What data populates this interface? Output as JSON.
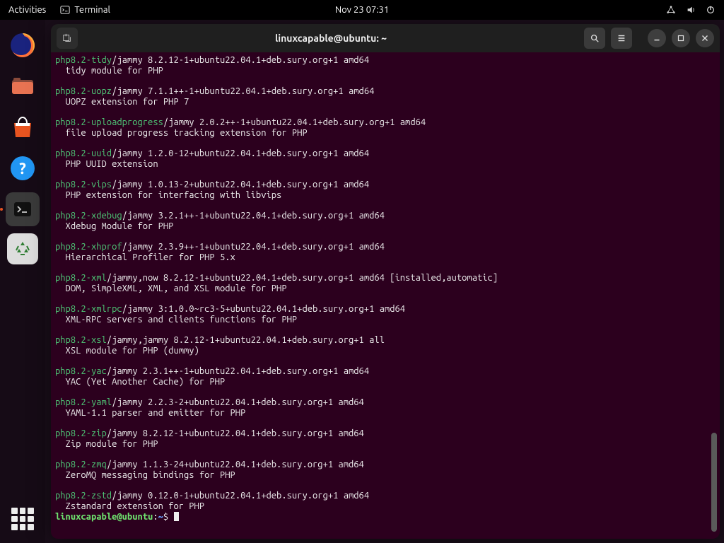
{
  "topbar": {
    "activities": "Activities",
    "terminal": "Terminal",
    "datetime": "Nov 23  07:31"
  },
  "window": {
    "title": "linuxcapable@ubuntu: ~"
  },
  "prompt": {
    "user_host": "linuxcapable@ubuntu",
    "sep": ":",
    "path": "~",
    "dollar": "$ "
  },
  "packages": [
    {
      "name": "php8.2-tidy",
      "version": "/jammy 8.2.12-1+ubuntu22.04.1+deb.sury.org+1 amd64",
      "desc": "  tidy module for PHP"
    },
    {
      "name": "php8.2-uopz",
      "version": "/jammy 7.1.1++-1+ubuntu22.04.1+deb.sury.org+1 amd64",
      "desc": "  UOPZ extension for PHP 7"
    },
    {
      "name": "php8.2-uploadprogress",
      "version": "/jammy 2.0.2++-1+ubuntu22.04.1+deb.sury.org+1 amd64",
      "desc": "  file upload progress tracking extension for PHP"
    },
    {
      "name": "php8.2-uuid",
      "version": "/jammy 1.2.0-12+ubuntu22.04.1+deb.sury.org+1 amd64",
      "desc": "  PHP UUID extension"
    },
    {
      "name": "php8.2-vips",
      "version": "/jammy 1.0.13-2+ubuntu22.04.1+deb.sury.org+1 amd64",
      "desc": "  PHP extension for interfacing with libvips"
    },
    {
      "name": "php8.2-xdebug",
      "version": "/jammy 3.2.1++-1+ubuntu22.04.1+deb.sury.org+1 amd64",
      "desc": "  Xdebug Module for PHP"
    },
    {
      "name": "php8.2-xhprof",
      "version": "/jammy 2.3.9++-1+ubuntu22.04.1+deb.sury.org+1 amd64",
      "desc": "  Hierarchical Profiler for PHP 5.x"
    },
    {
      "name": "php8.2-xml",
      "version": "/jammy,now 8.2.12-1+ubuntu22.04.1+deb.sury.org+1 amd64 [installed,automatic]",
      "desc": "  DOM, SimpleXML, XML, and XSL module for PHP"
    },
    {
      "name": "php8.2-xmlrpc",
      "version": "/jammy 3:1.0.0~rc3-5+ubuntu22.04.1+deb.sury.org+1 amd64",
      "desc": "  XML-RPC servers and clients functions for PHP"
    },
    {
      "name": "php8.2-xsl",
      "version": "/jammy,jammy 8.2.12-1+ubuntu22.04.1+deb.sury.org+1 all",
      "desc": "  XSL module for PHP (dummy)"
    },
    {
      "name": "php8.2-yac",
      "version": "/jammy 2.3.1++-1+ubuntu22.04.1+deb.sury.org+1 amd64",
      "desc": "  YAC (Yet Another Cache) for PHP"
    },
    {
      "name": "php8.2-yaml",
      "version": "/jammy 2.2.3-2+ubuntu22.04.1+deb.sury.org+1 amd64",
      "desc": "  YAML-1.1 parser and emitter for PHP"
    },
    {
      "name": "php8.2-zip",
      "version": "/jammy 8.2.12-1+ubuntu22.04.1+deb.sury.org+1 amd64",
      "desc": "  Zip module for PHP"
    },
    {
      "name": "php8.2-zmq",
      "version": "/jammy 1.1.3-24+ubuntu22.04.1+deb.sury.org+1 amd64",
      "desc": "  ZeroMQ messaging bindings for PHP"
    },
    {
      "name": "php8.2-zstd",
      "version": "/jammy 0.12.0-1+ubuntu22.04.1+deb.sury.org+1 amd64",
      "desc": "  Zstandard extension for PHP"
    }
  ],
  "colors": {
    "package": "#4ec977",
    "prompt_user": "#6fe36f",
    "prompt_path": "#6aa0ff",
    "term_bg": "#2c001e",
    "accent": "#e95420"
  }
}
